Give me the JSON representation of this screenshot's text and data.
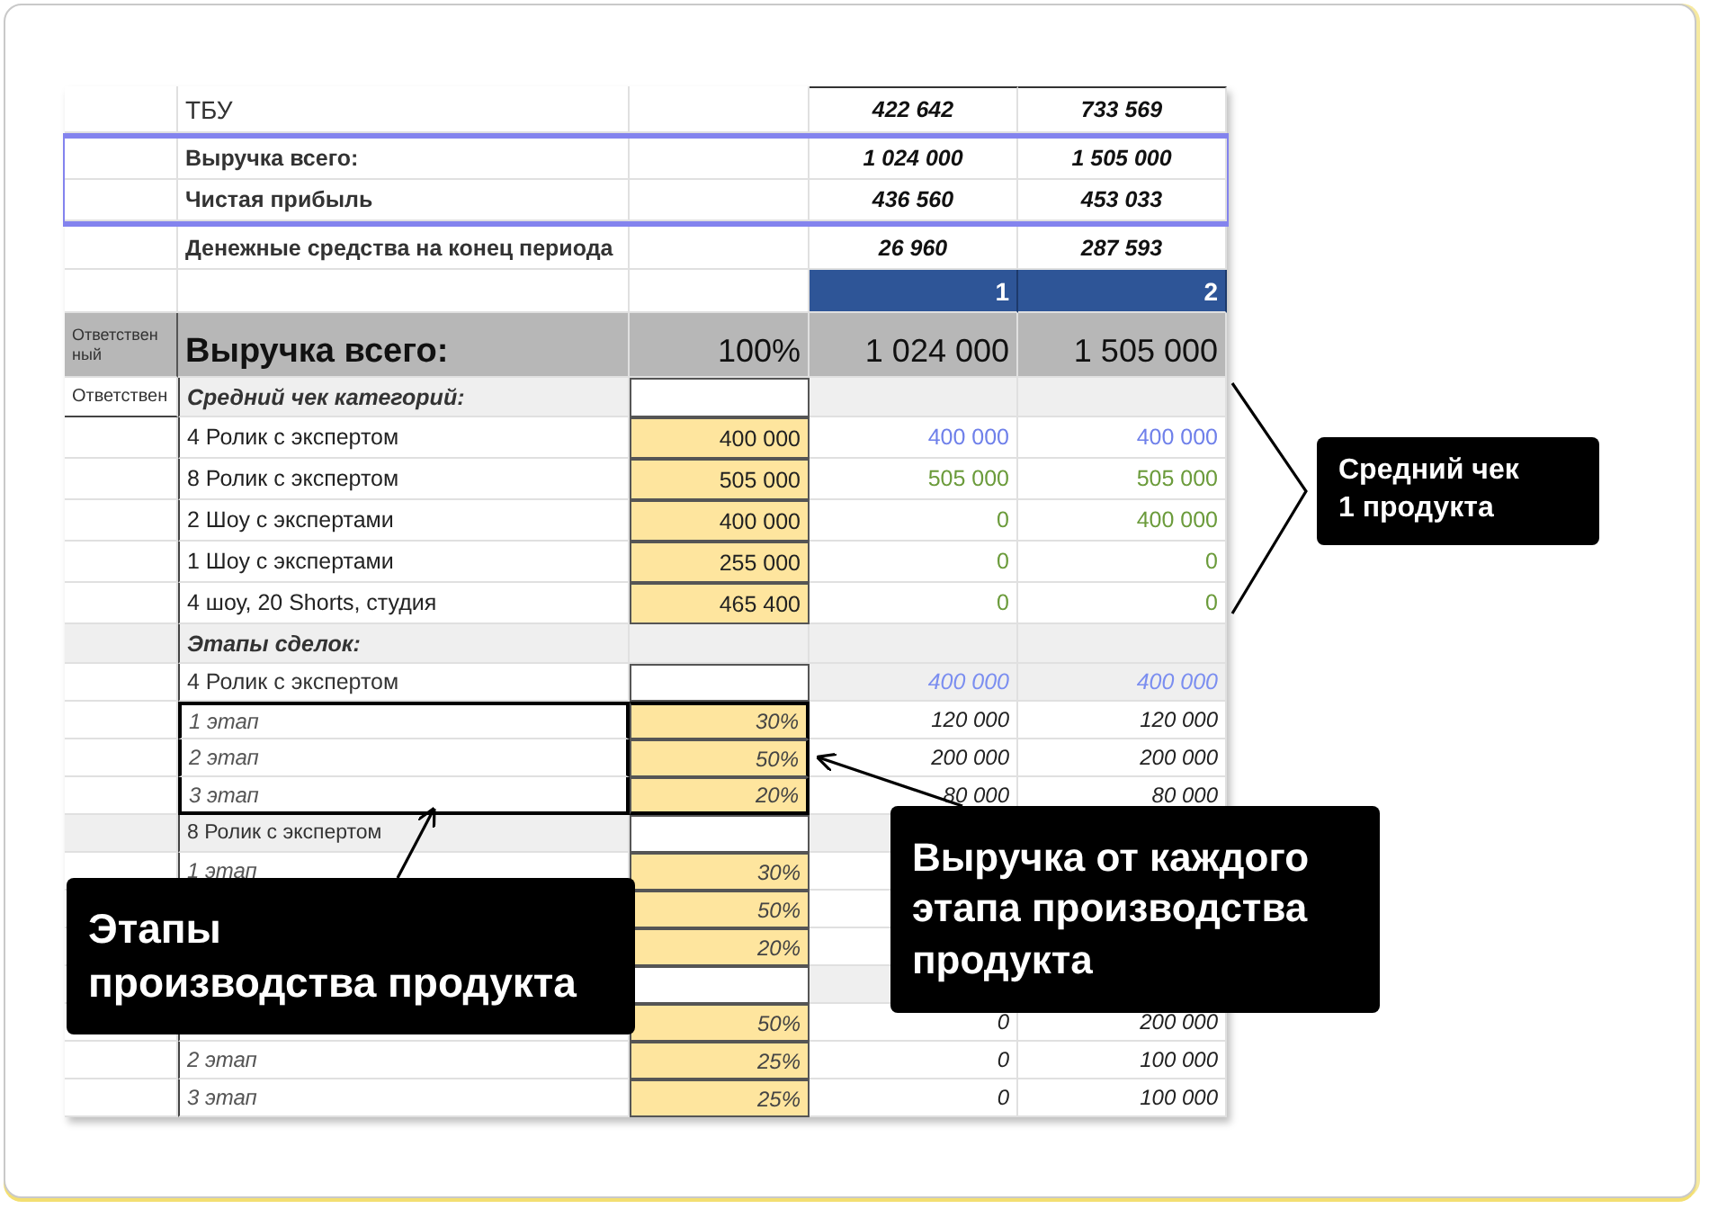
{
  "sheet": {
    "rows": [
      {
        "kind": "tbu",
        "label": "ТБУ",
        "values": [
          "422 642",
          "733 569"
        ]
      },
      {
        "kind": "highlight",
        "label": "Выручка всего:",
        "values": [
          "1 024 000",
          "1 505 000"
        ]
      },
      {
        "kind": "highlight",
        "label": "Чистая прибыль",
        "values": [
          "436 560",
          "453 033"
        ]
      },
      {
        "kind": "cash",
        "label": "Денежные средства на конец периода",
        "values": [
          "26 960",
          "287 593"
        ]
      },
      {
        "kind": "period_header",
        "values": [
          "1",
          "2"
        ]
      },
      {
        "kind": "total",
        "owner": "Ответствен ный",
        "label": "Выручка всего:",
        "share": "100%",
        "values": [
          "1 024 000",
          "1 505 000"
        ]
      },
      {
        "kind": "section",
        "owner": "Ответствен",
        "label": "Средний чек категорий:",
        "share_field": true
      },
      {
        "kind": "price",
        "label": "4 Ролик с экспертом",
        "share": "400 000",
        "values": [
          "400 000",
          "400 000"
        ],
        "color": "#6f80ea"
      },
      {
        "kind": "price",
        "label": "8 Ролик с экспертом",
        "share": "505 000",
        "values": [
          "505 000",
          "505 000"
        ],
        "color": "#6b9b3b"
      },
      {
        "kind": "price",
        "label": "2 Шоу с экспертами",
        "share": "400 000",
        "values": [
          "0",
          "400 000"
        ],
        "color": "#6b9b3b"
      },
      {
        "kind": "price",
        "label": "1 Шоу с экспертами",
        "share": "255 000",
        "values": [
          "0",
          "0"
        ],
        "color": "#6b9b3b"
      },
      {
        "kind": "price",
        "label": "4 шоу, 20 Shorts, студия",
        "share": "465 400",
        "values": [
          "0",
          "0"
        ],
        "color": "#6b9b3b"
      },
      {
        "kind": "section",
        "label": "Этапы сделок:",
        "share_field": false
      },
      {
        "kind": "product",
        "label": "4 Ролик с экспертом",
        "shaded": false,
        "values": [
          "400 000",
          "400 000"
        ],
        "color": "#7b8ef0"
      },
      {
        "kind": "stage",
        "label": "1 этап",
        "share": "30%",
        "values": [
          "120 000",
          "120 000"
        ],
        "outlined": true
      },
      {
        "kind": "stage",
        "label": "2 этап",
        "share": "50%",
        "values": [
          "200 000",
          "200 000"
        ],
        "outlined": true
      },
      {
        "kind": "stage",
        "label": "3 этап",
        "share": "20%",
        "values": [
          "80 000",
          "80 000"
        ],
        "outlined": true
      },
      {
        "kind": "product",
        "label": "8 Ролик с экспертом",
        "shaded": true
      },
      {
        "kind": "stage",
        "label": "1 этап",
        "share": "30%",
        "outlined": false
      },
      {
        "kind": "stage",
        "share": "50%",
        "outlined": false
      },
      {
        "kind": "stage",
        "share": "20%",
        "outlined": false
      },
      {
        "kind": "product"
      },
      {
        "kind": "stage",
        "share": "50%",
        "values": [
          "0",
          "200 000"
        ],
        "outlined": false
      },
      {
        "kind": "stage",
        "label": "2 этап",
        "share": "25%",
        "values": [
          "0",
          "100 000"
        ],
        "outlined": false
      },
      {
        "kind": "stage",
        "label": "3 этап",
        "share": "25%",
        "values": [
          "0",
          "100 000"
        ],
        "outlined": false
      }
    ]
  },
  "callouts": [
    {
      "kind": "average_check",
      "lines": [
        "Средний чек",
        "1 продукта"
      ]
    },
    {
      "kind": "stage_revenue",
      "lines": [
        "Выручка от каждого",
        "этапа производства",
        "продукта"
      ]
    },
    {
      "kind": "production_stages",
      "lines": [
        "Этапы",
        "производства продукта"
      ]
    }
  ]
}
